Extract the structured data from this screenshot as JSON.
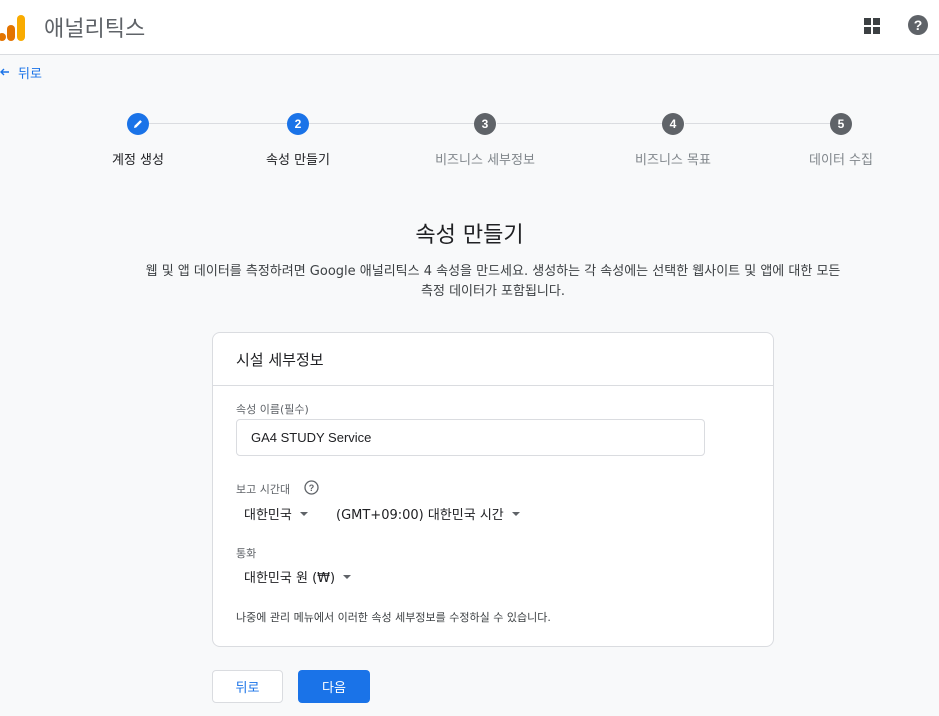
{
  "header": {
    "app_title": "애널리틱스",
    "icons": {
      "logo": "analytics-logo",
      "apps": "apps-grid-icon",
      "help": "help-icon"
    }
  },
  "back_link": {
    "label": "뒤로",
    "icon": "arrow-back-icon"
  },
  "stepper": {
    "steps": [
      {
        "number": "",
        "label": "계정 생성",
        "state": "done"
      },
      {
        "number": "2",
        "label": "속성 만들기",
        "state": "current"
      },
      {
        "number": "3",
        "label": "비즈니스 세부정보",
        "state": "pending"
      },
      {
        "number": "4",
        "label": "비즈니스 목표",
        "state": "pending"
      },
      {
        "number": "5",
        "label": "데이터 수집",
        "state": "pending"
      }
    ]
  },
  "page": {
    "title": "속성 만들기",
    "description_line1": "웹 및 앱 데이터를 측정하려면 Google 애널리틱스 4 속성을 만드세요. 생성하는 각 속성에는 선택한 웹사이트 및 앱에 대한 모든",
    "description_line2": "측정 데이터가 포함됩니다."
  },
  "card": {
    "title": "시설 세부정보",
    "property_name": {
      "label": "속성 이름(필수)",
      "value": "GA4 STUDY Service"
    },
    "reporting_timezone": {
      "label": "보고 시간대",
      "country": "대한민국",
      "timezone": "(GMT+09:00) 대한민국 시간"
    },
    "currency": {
      "label": "통화",
      "value": "대한민국 원 (₩)"
    },
    "footnote": "나중에 관리 메뉴에서 이러한 속성 세부정보를 수정하실 수 있습니다."
  },
  "buttons": {
    "back": "뒤로",
    "next": "다음"
  },
  "colors": {
    "primary": "#1a73e8",
    "logo_orange": "#f9ab00",
    "logo_dark_orange": "#e37400",
    "inactive_step": "#5f6368"
  }
}
